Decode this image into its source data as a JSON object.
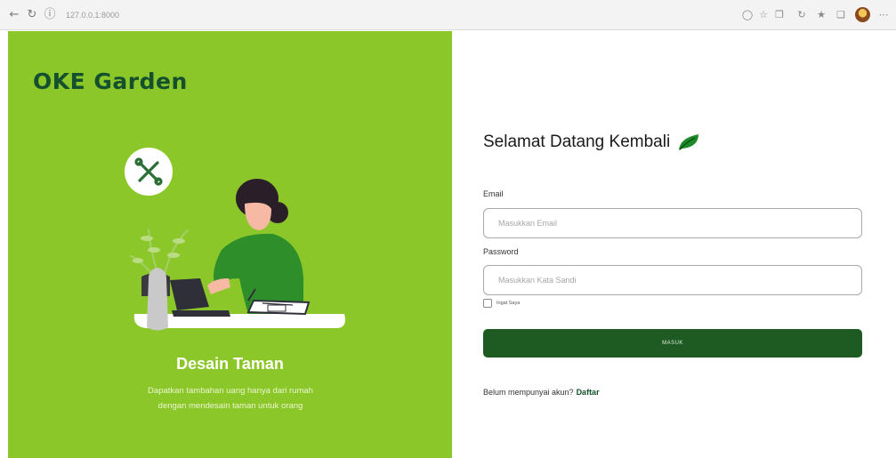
{
  "browser": {
    "url": "127.0.0.1:8000",
    "icons": [
      "back-arrow-icon",
      "reload-icon",
      "info-icon",
      "read-aloud-icon",
      "star-icon",
      "split-screen-icon",
      "refresh-icon",
      "favorites-icon",
      "collections-icon",
      "profile-icon",
      "more-icon"
    ]
  },
  "brand": {
    "name": "OKE Garden"
  },
  "hero": {
    "title": "Desain Taman",
    "description_line1": "Dapatkan tambahan uang hanya dari rumah",
    "description_line2": "dengan mendesain taman untuk orang"
  },
  "login": {
    "heading": "Selamat Datang Kembali",
    "email_label": "Email",
    "email_placeholder": "Masukkan Email",
    "password_label": "Password",
    "password_placeholder": "Masukkan Kata Sandi",
    "remember_label": "Ingat Saya",
    "submit_label": "MASUK",
    "signup_prompt": "Belum mempunyai akun?",
    "signup_link": "Daftar"
  },
  "colors": {
    "panel_green": "#8cc72a",
    "brand_dark_green": "#14502d",
    "button_green": "#1e5b23",
    "white": "#ffffff"
  }
}
